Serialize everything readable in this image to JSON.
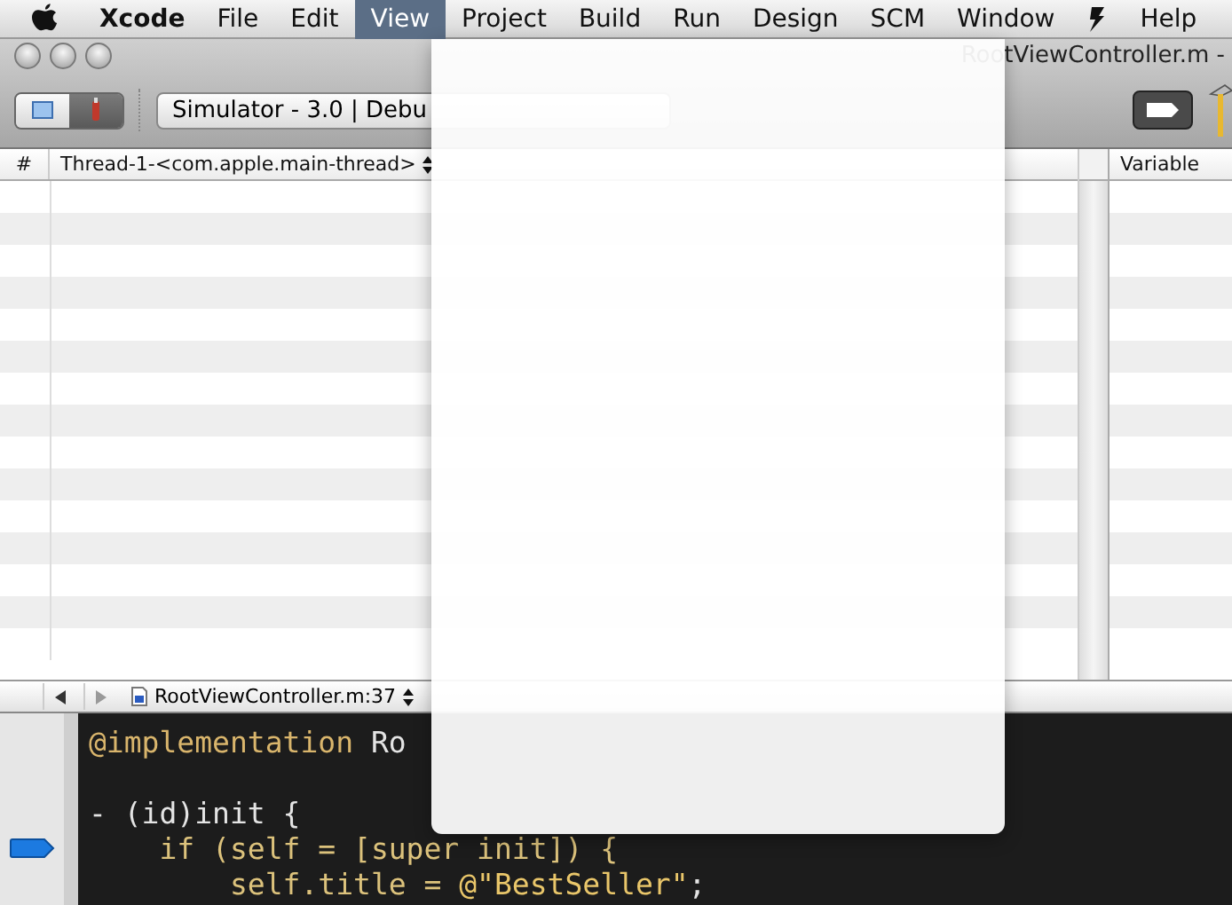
{
  "menu_bar": {
    "items": [
      {
        "label": "Xcode",
        "kind": "app",
        "selected": false
      },
      {
        "label": "File",
        "kind": "menu",
        "selected": false
      },
      {
        "label": "Edit",
        "kind": "menu",
        "selected": false
      },
      {
        "label": "View",
        "kind": "menu",
        "selected": true
      },
      {
        "label": "Project",
        "kind": "menu",
        "selected": false
      },
      {
        "label": "Build",
        "kind": "menu",
        "selected": false
      },
      {
        "label": "Run",
        "kind": "menu",
        "selected": false
      },
      {
        "label": "Design",
        "kind": "menu",
        "selected": false
      },
      {
        "label": "SCM",
        "kind": "menu",
        "selected": false
      },
      {
        "label": "Window",
        "kind": "menu",
        "selected": false
      },
      {
        "kind": "script",
        "selected": false
      },
      {
        "label": "Help",
        "kind": "menu",
        "selected": false
      }
    ]
  },
  "window": {
    "title": "RootViewController.m -"
  },
  "toolbar": {
    "scheme_popup": "Simulator - 3.0 | Debu"
  },
  "thread_table": {
    "columns": [
      "#",
      "Thread-1-<com.apple.main-thread>"
    ]
  },
  "variables_table": {
    "columns": [
      "Variable"
    ]
  },
  "editor": {
    "file_popup": "RootViewController.m:37",
    "lines": [
      {
        "breakpoint": false,
        "segments": [
          {
            "text": "@implementation",
            "kind": "directive"
          },
          {
            "text": " Ro",
            "kind": "plain"
          }
        ]
      },
      {
        "breakpoint": false,
        "segments": [
          {
            "text": "- (id)init {",
            "kind": "plain"
          }
        ]
      },
      {
        "breakpoint": true,
        "segments": [
          {
            "text": "    if (self = [super init]) {",
            "kind": "keyword"
          }
        ]
      },
      {
        "breakpoint": false,
        "segments": [
          {
            "text": "        self.title = ",
            "kind": "keyword"
          },
          {
            "text": "@\"BestSeller\"",
            "kind": "string"
          },
          {
            "text": ";",
            "kind": "plain"
          }
        ]
      }
    ]
  },
  "open_menu": {
    "kind": "empty"
  }
}
